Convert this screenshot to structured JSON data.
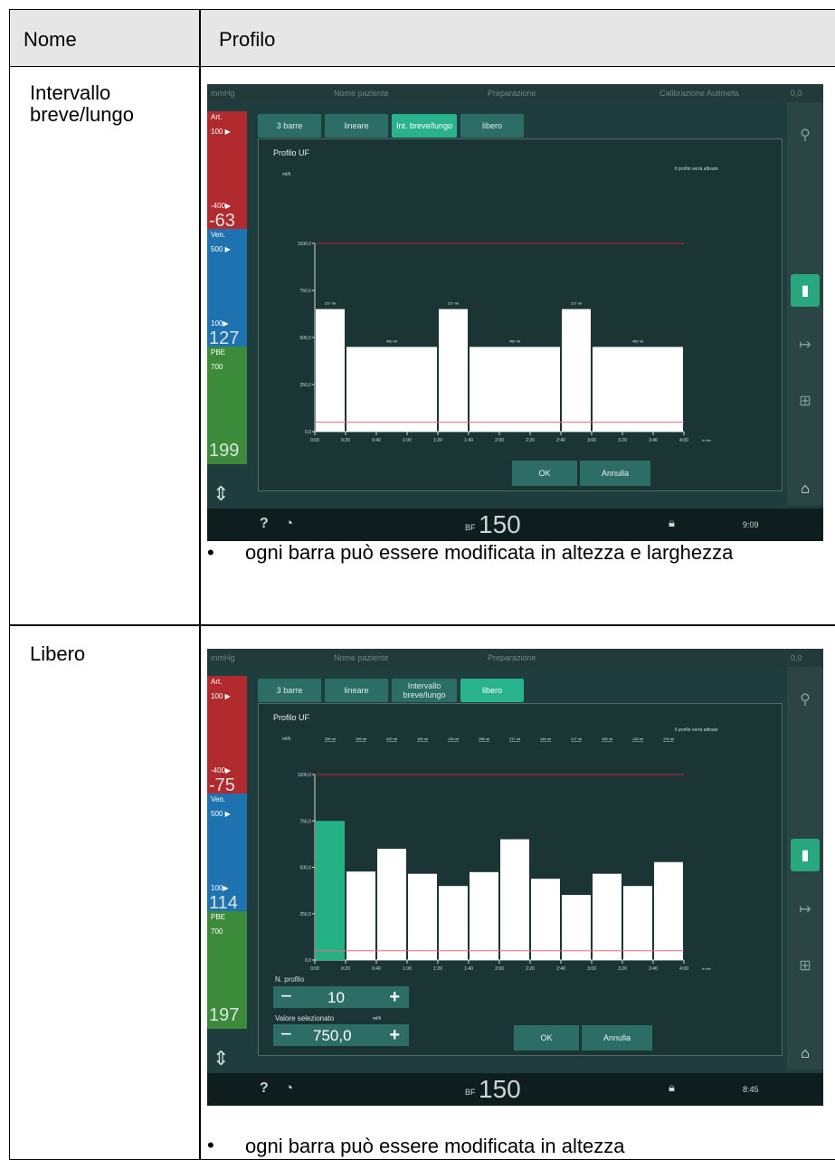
{
  "header": {
    "col1": "Nome",
    "col2": "Profilo"
  },
  "rows": [
    {
      "name": "Intervallo breve/lungo",
      "bullet": "ogni barra può essere modificata in altezza e larghezza",
      "screen": {
        "topbar": {
          "left": "mmHg",
          "patient": "Nome paziente",
          "phase": "Preparazione",
          "right": "Calibrazione Autimeta",
          "status": "0,0"
        },
        "sidebar": {
          "art": "Art.",
          "art_top": "100 ▶",
          "art_bottom": "-400▶",
          "art_value": "-63",
          "ven": "Ven.",
          "ven_top": "500 ▶",
          "ven_bottom": "100▶",
          "ven_value": "127",
          "pbe": "PBE",
          "pbe_top": "700",
          "pbe_value": "199"
        },
        "tabs": [
          "3 barre",
          "lineare",
          "Int. breve/lungo",
          "libero"
        ],
        "selected_tab": 2,
        "panel_title": "Profilo UF",
        "note": "Il profilo verrà attivato",
        "unit_y": "ml/h",
        "ok": "OK",
        "cancel": "Annulla",
        "bf_label": "BF",
        "bf_value": "150",
        "time": "9:09"
      }
    },
    {
      "name": "Libero",
      "bullet": "ogni barra può essere modificata in altezza",
      "screen": {
        "topbar": {
          "left": "mmHg",
          "patient": "Nome paziente",
          "phase": "Preparazione",
          "right": "",
          "status": "0,0"
        },
        "sidebar": {
          "art": "Art.",
          "art_top": "100 ▶",
          "art_bottom": "-400▶",
          "art_value": "-75",
          "ven": "Ven.",
          "ven_top": "500 ▶",
          "ven_bottom": "100▶",
          "ven_value": "114",
          "pbe": "PBE",
          "pbe_top": "700",
          "pbe_value": "197"
        },
        "tabs": [
          "3 barre",
          "lineare",
          "Intervallo breve/lungo",
          "libero"
        ],
        "selected_tab": 3,
        "panel_title": "Profilo UF",
        "note": "Il profilo verrà attivato",
        "unit_y": "ml/h",
        "profile_label": "N. profilo",
        "profile_value": "10",
        "selected_label": "Valore selezionato",
        "selected_unit": "ml/h",
        "selected_value": "750,0",
        "ok": "OK",
        "cancel": "Annulla",
        "bf_label": "BF",
        "bf_value": "150",
        "time": "8:45"
      }
    }
  ],
  "chart_data": [
    {
      "type": "bar",
      "title": "Profilo UF",
      "ylabel": "ml/h",
      "xlabel": "h:min",
      "ylim": [
        0,
        1000
      ],
      "yticks": [
        "0,0",
        "250,0",
        "500,0",
        "750,0",
        "1000,0"
      ],
      "xticks": [
        "0:00",
        "0:20",
        "0:40",
        "1:00",
        "1:20",
        "1:40",
        "2:00",
        "2:20",
        "2:40",
        "3:00",
        "3:20",
        "3:40",
        "4:00"
      ],
      "bars": [
        {
          "start": 0,
          "end": 20,
          "value": 651,
          "label": "217 ml"
        },
        {
          "start": 20,
          "end": 80,
          "value": 450,
          "label": "450 ml"
        },
        {
          "start": 80,
          "end": 100,
          "value": 651,
          "label": "217 ml"
        },
        {
          "start": 100,
          "end": 160,
          "value": 450,
          "label": "450 ml"
        },
        {
          "start": 160,
          "end": 180,
          "value": 651,
          "label": "217 ml"
        },
        {
          "start": 180,
          "end": 240,
          "value": 450,
          "label": "450 ml"
        }
      ],
      "max_line": 1000,
      "min_line": 50,
      "colors": {
        "bar": "#ffffff",
        "max_line": "#c0283a",
        "min_line": "#e46a78",
        "axis": "#d0dcdb"
      }
    },
    {
      "type": "bar",
      "title": "Profilo UF",
      "ylabel": "ml/h",
      "xlabel": "h:min",
      "ylim": [
        0,
        1000
      ],
      "yticks": [
        "0,0",
        "250,0",
        "500,0",
        "750,0",
        "1000,0"
      ],
      "xticks": [
        "0:00",
        "0:20",
        "0:40",
        "1:00",
        "1:20",
        "1:40",
        "2:00",
        "2:20",
        "2:40",
        "3:00",
        "3:20",
        "3:40",
        "4:00"
      ],
      "top_labels": [
        "250 ml",
        "159 ml",
        "200 ml",
        "155 ml",
        "133 ml",
        "158 ml",
        "217 ml",
        "146 ml",
        "117 ml",
        "155 ml",
        "133 ml",
        "176 ml"
      ],
      "bars": [
        {
          "start": 0,
          "end": 20,
          "value": 750,
          "selected": true
        },
        {
          "start": 20,
          "end": 40,
          "value": 477
        },
        {
          "start": 40,
          "end": 60,
          "value": 600
        },
        {
          "start": 60,
          "end": 80,
          "value": 465
        },
        {
          "start": 80,
          "end": 100,
          "value": 399
        },
        {
          "start": 100,
          "end": 120,
          "value": 474
        },
        {
          "start": 120,
          "end": 140,
          "value": 651
        },
        {
          "start": 140,
          "end": 160,
          "value": 438
        },
        {
          "start": 160,
          "end": 180,
          "value": 351
        },
        {
          "start": 180,
          "end": 200,
          "value": 465
        },
        {
          "start": 200,
          "end": 220,
          "value": 399
        },
        {
          "start": 220,
          "end": 240,
          "value": 528
        }
      ],
      "max_line": 1000,
      "min_line": 50,
      "colors": {
        "bar": "#ffffff",
        "selected": "#24b285",
        "max_line": "#c0283a",
        "min_line": "#e46a78",
        "axis": "#d0dcdb"
      }
    }
  ]
}
